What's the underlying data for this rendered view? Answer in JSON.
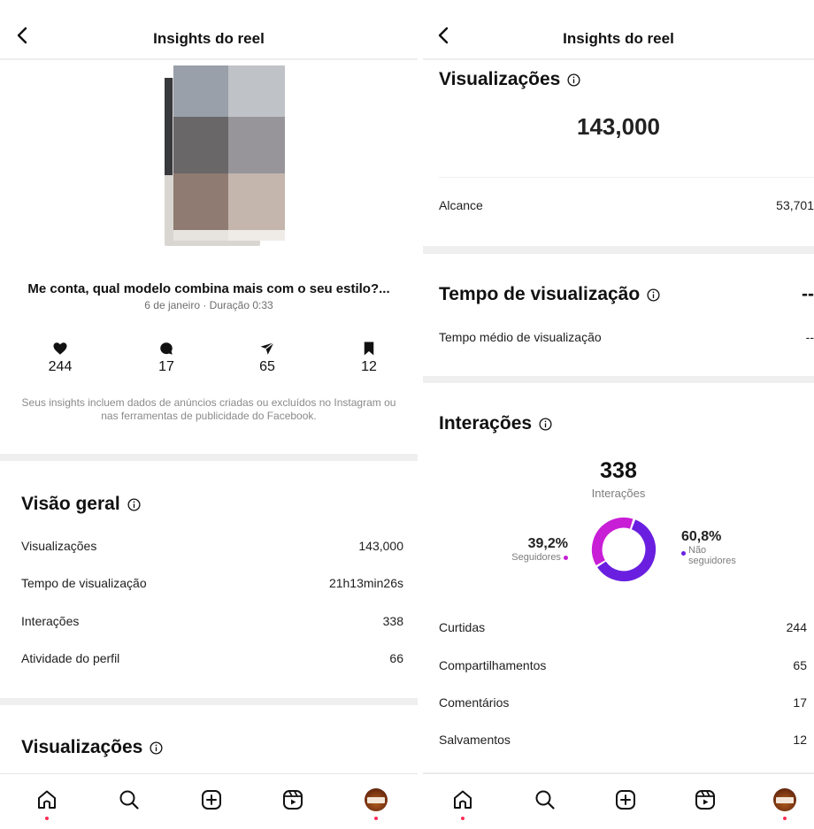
{
  "header": {
    "title": "Insights do reel"
  },
  "left": {
    "reel": {
      "title": "Me conta, qual modelo combina mais com o seu estilo?...",
      "subtitle": "6 de janeiro · Duração 0:33"
    },
    "stats": [
      {
        "icon": "heart-icon",
        "value": "244"
      },
      {
        "icon": "comment-icon",
        "value": "17"
      },
      {
        "icon": "share-icon",
        "value": "65"
      },
      {
        "icon": "bookmark-icon",
        "value": "12"
      }
    ],
    "note": "Seus insights incluem dados de anúncios criadas ou excluídos no Instagram ou nas ferramentas de publicidade do Facebook.",
    "overview": {
      "title": "Visão geral",
      "rows": [
        {
          "label": "Visualizações",
          "value": "143,000"
        },
        {
          "label": "Tempo de visualização",
          "value": "21h13min26s"
        },
        {
          "label": "Interações",
          "value": "338"
        },
        {
          "label": "Atividade do perfil",
          "value": "66"
        }
      ]
    },
    "views_title": "Visualizações"
  },
  "right": {
    "views": {
      "title": "Visualizações",
      "total": "143,000",
      "reach_label": "Alcance",
      "reach_value": "53,701"
    },
    "watch_time": {
      "title": "Tempo de visualização",
      "value": "--",
      "avg_label": "Tempo médio de visualização",
      "avg_value": "--"
    },
    "interactions": {
      "title": "Interações",
      "total": "338",
      "total_label": "Interações",
      "followers_pct": "39,2%",
      "followers_label": "Seguidores",
      "nonfollowers_pct": "60,8%",
      "nonfollowers_label_1": "Não",
      "nonfollowers_label_2": "seguidores",
      "rows": [
        {
          "label": "Curtidas",
          "value": "244"
        },
        {
          "label": "Compartilhamentos",
          "value": "65"
        },
        {
          "label": "Comentários",
          "value": "17"
        },
        {
          "label": "Salvamentos",
          "value": "12"
        }
      ]
    }
  },
  "chart_data": {
    "type": "pie",
    "categories": [
      "Seguidores",
      "Não seguidores"
    ],
    "values": [
      39.2,
      60.8
    ],
    "colors": [
      "#c81ed6",
      "#6a1fe0"
    ]
  },
  "nav": [
    "home-icon",
    "search-icon",
    "create-icon",
    "reels-icon",
    "profile-avatar"
  ],
  "colors": {
    "accent_follow": "#c81ed6",
    "accent_nonfollow": "#6a1fe0",
    "nav_dot": "#ff2d55"
  }
}
